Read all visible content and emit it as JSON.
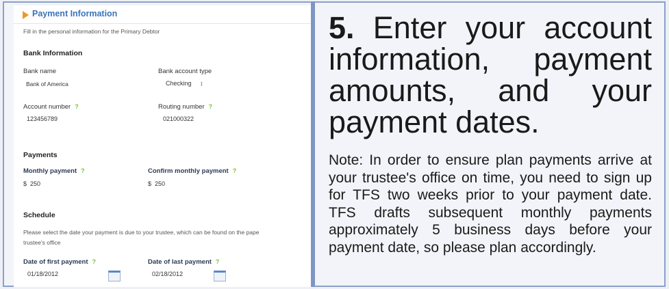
{
  "form": {
    "title": "Payment Information",
    "intro": "Fill in the personal information for the Primary Debtor",
    "bank": {
      "heading": "Bank Information",
      "bank_name_label": "Bank name",
      "bank_name_value": "Bank of America",
      "account_type_label": "Bank account type",
      "account_type_value": "Checking",
      "account_type_arrow": "↕",
      "account_number_label": "Account number",
      "account_number_value": "123456789",
      "routing_number_label": "Routing number",
      "routing_number_value": "021000322",
      "help_mark": "?"
    },
    "payments": {
      "heading": "Payments",
      "monthly_label": "Monthly payment",
      "monthly_value": "$  250",
      "confirm_label": "Confirm monthly payment",
      "confirm_value": "$  250"
    },
    "schedule": {
      "heading": "Schedule",
      "description_line1": "Please select the date your payment is due to your trustee, which can be found on the pape",
      "description_line2": "trustee's office",
      "first_label": "Date of first payment",
      "first_value": "01/18/2012",
      "last_label": "Date of last payment",
      "last_value": "02/18/2012"
    }
  },
  "instruction": {
    "step_number": "5.",
    "step_text": " Enter your account information, payment amounts, and your payment dates.",
    "note": "Note:  In order to ensure plan payments arrive at your trustee's office on time, you need to sign up  for TFS two weeks prior to your payment date. TFS drafts subsequent monthly payments approximately 5 business days before your payment date, so please plan accordingly."
  },
  "colors": {
    "accent_blue": "#3a74b8",
    "accent_orange": "#f0962a",
    "help_green": "#7cc33c",
    "border_blue": "#7f96c4"
  }
}
